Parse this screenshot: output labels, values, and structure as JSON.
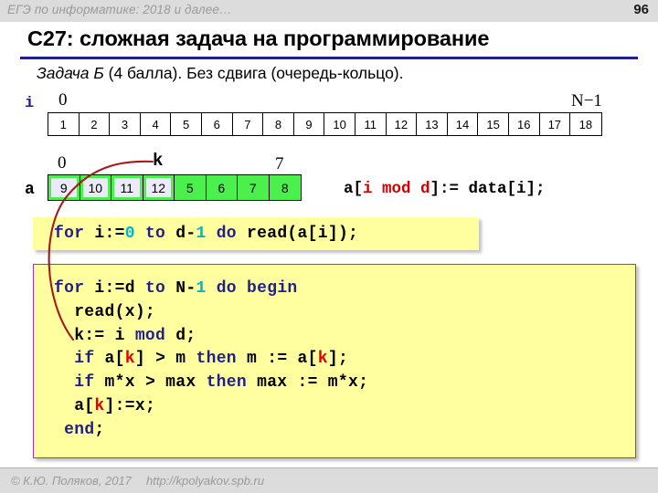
{
  "header": {
    "title": "ЕГЭ по информатике: 2018 и далее…",
    "page_number": "96",
    "rule_color": "#1f1f8f",
    "band_color": "#dcdcdc"
  },
  "slide": {
    "title": "C27: сложная задача на программирование",
    "subtitle_italic": "Задача Б",
    "subtitle_rest": " (4 балла). Без сдвига (очередь-кольцо)."
  },
  "index_strip": {
    "label": "i",
    "label_color": "#1f1f8f",
    "left_bound": "0",
    "right_bound": "N−1",
    "cells": [
      "1",
      "2",
      "3",
      "4",
      "5",
      "6",
      "7",
      "8",
      "9",
      "10",
      "11",
      "12",
      "13",
      "14",
      "15",
      "16",
      "17",
      "18"
    ]
  },
  "array": {
    "label": "a",
    "left_bound": "0",
    "right_bound": "7",
    "pointer_label": "k",
    "fill_color": "#4cf04c",
    "highlight_color": "#eaeaf8",
    "cells": [
      {
        "value": "9",
        "highlighted": true
      },
      {
        "value": "10",
        "highlighted": true
      },
      {
        "value": "11",
        "highlighted": true
      },
      {
        "value": "12",
        "highlighted": true
      },
      {
        "value": "5",
        "highlighted": false
      },
      {
        "value": "6",
        "highlighted": false
      },
      {
        "value": "7",
        "highlighted": false
      },
      {
        "value": "8",
        "highlighted": false
      }
    ]
  },
  "formula": {
    "prefix": "a[",
    "red_part": "i mod d",
    "suffix": "]:= data[i];",
    "red_color": "#d40000"
  },
  "code_box_1": {
    "background": "#ffffa0",
    "tokens": [
      {
        "t": "for",
        "c": "kw"
      },
      {
        "t": " i:=",
        "c": ""
      },
      {
        "t": "0",
        "c": "num"
      },
      {
        "t": " ",
        "c": ""
      },
      {
        "t": "to",
        "c": "kw"
      },
      {
        "t": " d-",
        "c": ""
      },
      {
        "t": "1",
        "c": "num"
      },
      {
        "t": " ",
        "c": ""
      },
      {
        "t": "do",
        "c": "kw"
      },
      {
        "t": " read(a[i]);",
        "c": ""
      }
    ],
    "plain_text": "for i:=0 to d-1 do read(a[i]);"
  },
  "code_box_2": {
    "background": "#ffffa0",
    "border_color": "#b02fb0",
    "lines": [
      [
        {
          "t": "for",
          "c": "kw"
        },
        {
          "t": " i:=d ",
          "c": ""
        },
        {
          "t": "to",
          "c": "kw"
        },
        {
          "t": " N-",
          "c": ""
        },
        {
          "t": "1",
          "c": "num"
        },
        {
          "t": " ",
          "c": ""
        },
        {
          "t": "do",
          "c": "kw"
        },
        {
          "t": " ",
          "c": ""
        },
        {
          "t": "begin",
          "c": "kw"
        }
      ],
      [
        {
          "t": "  read(x);",
          "c": ""
        }
      ],
      [
        {
          "t": "  k:= i ",
          "c": ""
        },
        {
          "t": "mod",
          "c": "kw"
        },
        {
          "t": " d;",
          "c": ""
        }
      ],
      [
        {
          "t": "  ",
          "c": ""
        },
        {
          "t": "if",
          "c": "kw"
        },
        {
          "t": " a[",
          "c": ""
        },
        {
          "t": "k",
          "c": "rd"
        },
        {
          "t": "] > m ",
          "c": ""
        },
        {
          "t": "then",
          "c": "kw"
        },
        {
          "t": " m := a[",
          "c": ""
        },
        {
          "t": "k",
          "c": "rd"
        },
        {
          "t": "];",
          "c": ""
        }
      ],
      [
        {
          "t": "  ",
          "c": ""
        },
        {
          "t": "if",
          "c": "kw"
        },
        {
          "t": " m*x > max ",
          "c": ""
        },
        {
          "t": "then",
          "c": "kw"
        },
        {
          "t": " max := m*x;",
          "c": ""
        }
      ],
      [
        {
          "t": "  a[",
          "c": ""
        },
        {
          "t": "k",
          "c": "rd"
        },
        {
          "t": "]:=x;",
          "c": ""
        }
      ],
      [
        {
          "t": " ",
          "c": ""
        },
        {
          "t": "end",
          "c": "kw"
        },
        {
          "t": ";",
          "c": ""
        }
      ]
    ],
    "plain_text": "for i:=d to N-1 do begin\n  read(x);\n  k:= i mod d;\n  if a[k] > m then m := a[k];\n  if m*x > max then max := m*x;\n  a[k]:=x;\n end;"
  },
  "annotation_arrow": {
    "color": "#a81818",
    "from": "k:= i mod d;",
    "to": "k"
  },
  "footer": {
    "copyright": "© К.Ю. Поляков, 2017",
    "url": "http://kpolyakov.spb.ru",
    "band_color": "#dcdcdc"
  }
}
